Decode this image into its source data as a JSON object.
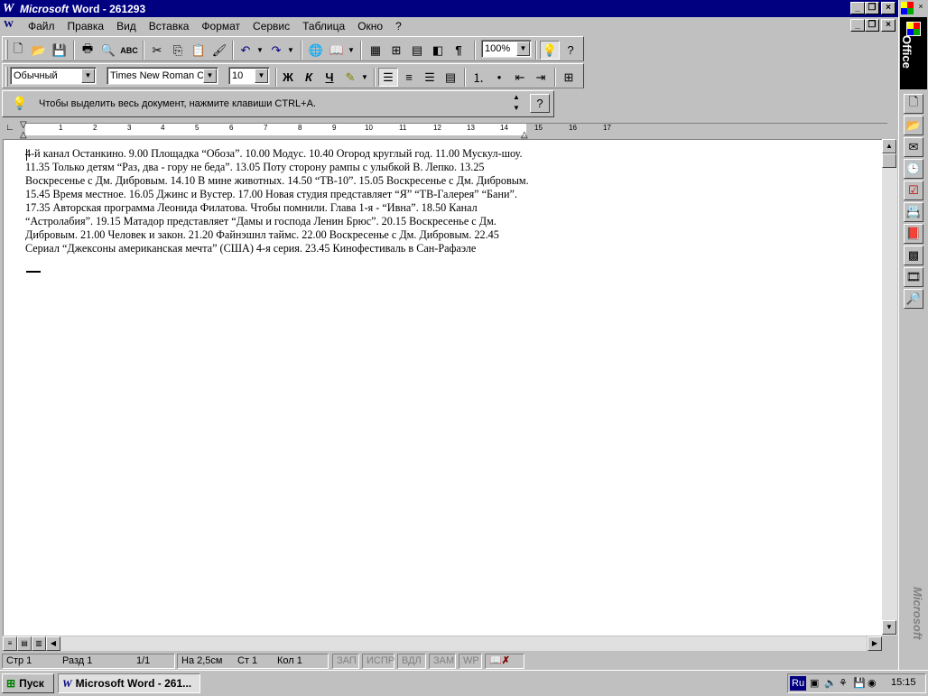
{
  "window": {
    "title_app": "Microsoft",
    "title_rest": "Word - 261293"
  },
  "menu": [
    "Файл",
    "Правка",
    "Вид",
    "Вставка",
    "Формат",
    "Сервис",
    "Таблица",
    "Окно",
    "?"
  ],
  "toolbar": {
    "zoom": "100%"
  },
  "format": {
    "style": "Обычный",
    "font": "Times New Roman C",
    "size": "10",
    "bold": "Ж",
    "italic": "К",
    "underline": "Ч"
  },
  "tip": {
    "text": "Чтобы выделить весь документ, нажмите клавиши CTRL+A."
  },
  "ruler": {
    "numbers": [
      "1",
      "2",
      "3",
      "4",
      "5",
      "6",
      "7",
      "8",
      "9",
      "10",
      "11",
      "12",
      "13",
      "14",
      "15",
      "16",
      "17"
    ]
  },
  "document": {
    "text": "4-й канал Останкино. 9.00 Площадка “Обоза”. 10.00 Модус. 10.40 Огород круглый год. 11.00 Мускул-шоу. 11.35 Только детям “Раз, два - гору не беда”. 13.05 Поту сторону рампы с улыбкой В. Лепко. 13.25 Воскресенье с Дм. Дибровым. 14.10 В мине животных. 14.50 “ТВ-10”. 15.05 Воскресенье с Дм. Дибровым. 15.45 Время местное. 16.05 Джинс и Вустер. 17.00 Новая студия представляет “Я” “ТВ-Галерея” “Бани”. 17.35 Авторская программа Леонида Филатова. Чтобы помнили. Глава 1-я - “Ивна”. 18.50 Канал “Астролабия”.  19.15 Матадор представляет “Дамы и господа Ленин Брюс”. 20.15 Воскресенье с Дм. Дибровым. 21.00 Человек и закон. 21.20 Файнэшнл таймс. 22.00 Воскресенье с Дм. Дибровым. 22.45 Сериал “Джексоны американская мечта” (США) 4-я серия. 23.45 Кинофестиваль в Сан-Рафаэле"
  },
  "status": {
    "page": "Стр 1",
    "section": "Разд 1",
    "pages": "1/1",
    "at": "На 2,5см",
    "line": "Ст 1",
    "col": "Кол 1",
    "rec": "ЗАП",
    "trk": "ИСПР",
    "ext": "ВДЛ",
    "ovr": "ЗАМ",
    "wph": "WP"
  },
  "officebar": {
    "label": "Office",
    "brand": "Microsoft"
  },
  "taskbar": {
    "start": "Пуск",
    "task": "Microsoft Word - 261...",
    "lang": "Ru",
    "time": "15:15"
  }
}
